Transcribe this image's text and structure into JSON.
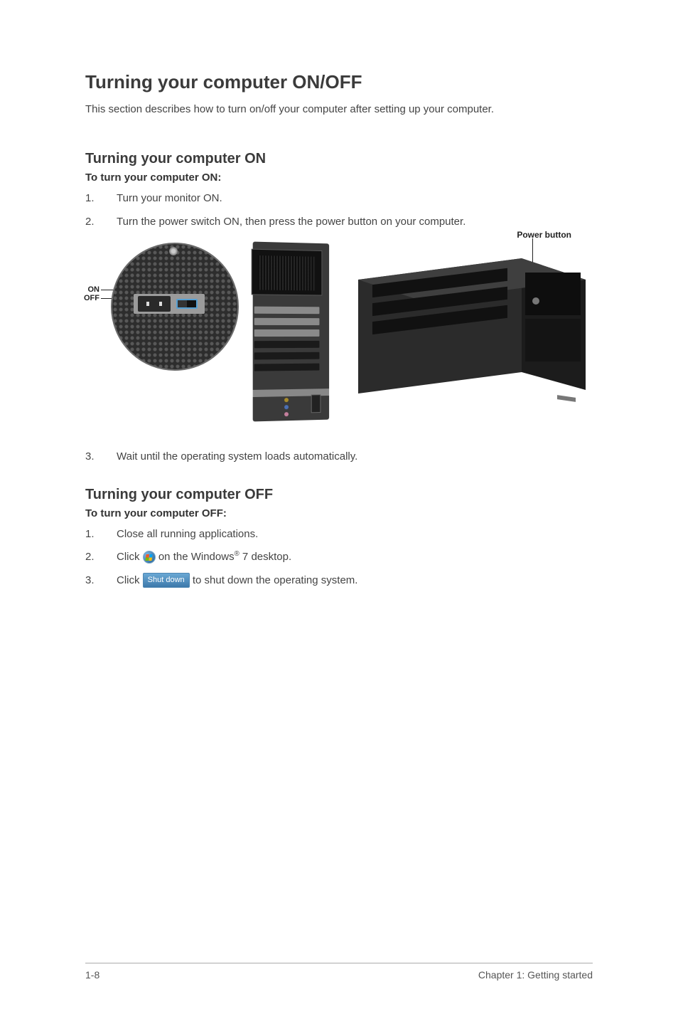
{
  "title": "Turning your computer ON/OFF",
  "intro": "This section describes how to turn on/off your computer after setting up your computer.",
  "on_section": {
    "heading": "Turning your computer ON",
    "sub": "To turn your computer ON:",
    "steps": [
      "Turn your monitor ON.",
      "Turn the power switch ON, then press the power button on your computer."
    ],
    "switch_label_on": "ON",
    "switch_label_off": "OFF",
    "power_label": "Power button",
    "step3": "Wait until the operating system loads automatically."
  },
  "off_section": {
    "heading": "Turning your computer OFF",
    "sub": "To turn your computer OFF:",
    "step1": "Close all running applications.",
    "step2_prefix": "Click ",
    "step2_mid": " on the Windows",
    "step2_suffix": " 7 desktop.",
    "reg": "®",
    "step3_prefix": "Click ",
    "shutdown_label": "Shut down",
    "step3_suffix": " to shut down the operating system."
  },
  "icons": {
    "start_orb": "windows-start-orb-icon",
    "shutdown": "shutdown-button"
  },
  "footer": {
    "left": "1-8",
    "right": "Chapter 1: Getting started"
  }
}
